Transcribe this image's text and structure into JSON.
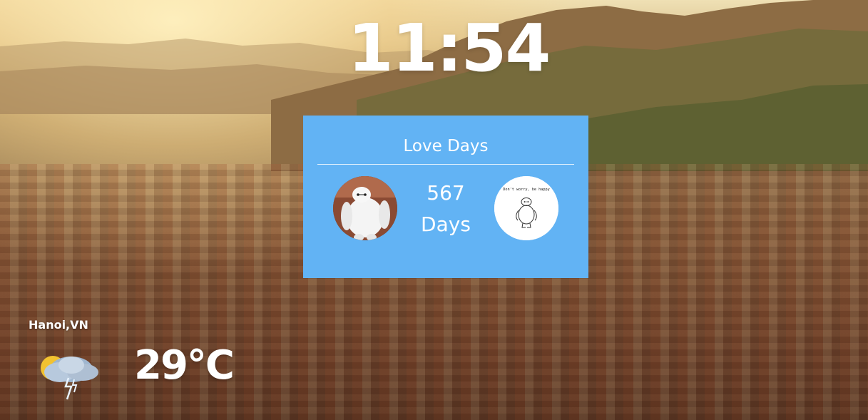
{
  "clock": {
    "time": "11:54"
  },
  "love_card": {
    "title": "Love Days",
    "count": "567",
    "unit": "Days",
    "accent_color": "#62b3f4",
    "left_avatar": {
      "icon": "baymax-icon"
    },
    "right_avatar": {
      "icon": "baymax-sketch-icon",
      "caption": "Don't worry, be happy"
    }
  },
  "weather": {
    "location": "Hanoi,VN",
    "temperature": "29°C",
    "icon": "thunderstorm-icon"
  }
}
